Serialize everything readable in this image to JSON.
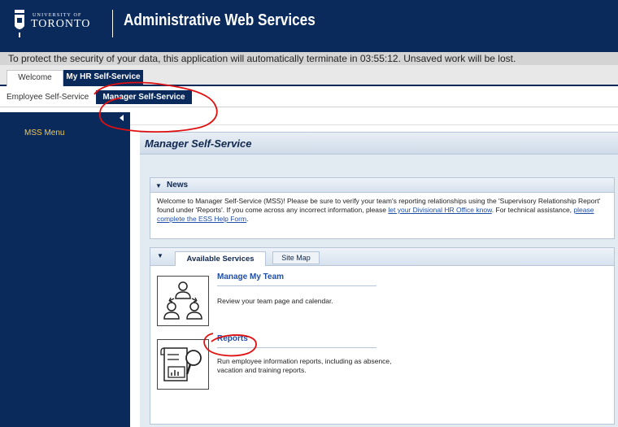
{
  "header": {
    "logo_small": "UNIVERSITY OF",
    "logo_big": "TORONTO",
    "app_title": "Administrative Web Services"
  },
  "banner": {
    "text": "To protect the security of your data, this application will automatically terminate in 03:55:12. Unsaved work will be lost."
  },
  "tabs": {
    "welcome": "Welcome",
    "my_hr": "My HR Self-Service"
  },
  "subtabs": {
    "ess": "Employee Self-Service",
    "mss": "Manager Self-Service"
  },
  "leftnav": {
    "menu_label": "MSS Menu"
  },
  "page": {
    "title": "Manager Self-Service"
  },
  "news": {
    "title": "News",
    "text_1": "Welcome to Manager Self-Service (MSS)! Please be sure to verify your team's reporting relationships using the 'Supervisory Relationship Report' found under 'Reports'. If you come across any incorrect information, please ",
    "link_1": "let your Divisional HR Office know",
    "text_2": ". For technical assistance, ",
    "link_2": "please complete the ESS Help Form",
    "text_3": "."
  },
  "services": {
    "tabs": [
      "Available Services",
      "Site Map"
    ],
    "items": [
      {
        "title": "Manage My Team",
        "description": "Review your team page and calendar."
      },
      {
        "title": "Reports",
        "description": "Run employee information reports, including as absence, vacation and training reports."
      }
    ]
  },
  "colors": {
    "brand_navy": "#0b2a5c",
    "menu_gold": "#f3c84b",
    "link_blue": "#1f4ea8",
    "annotation_red": "#e01010"
  }
}
